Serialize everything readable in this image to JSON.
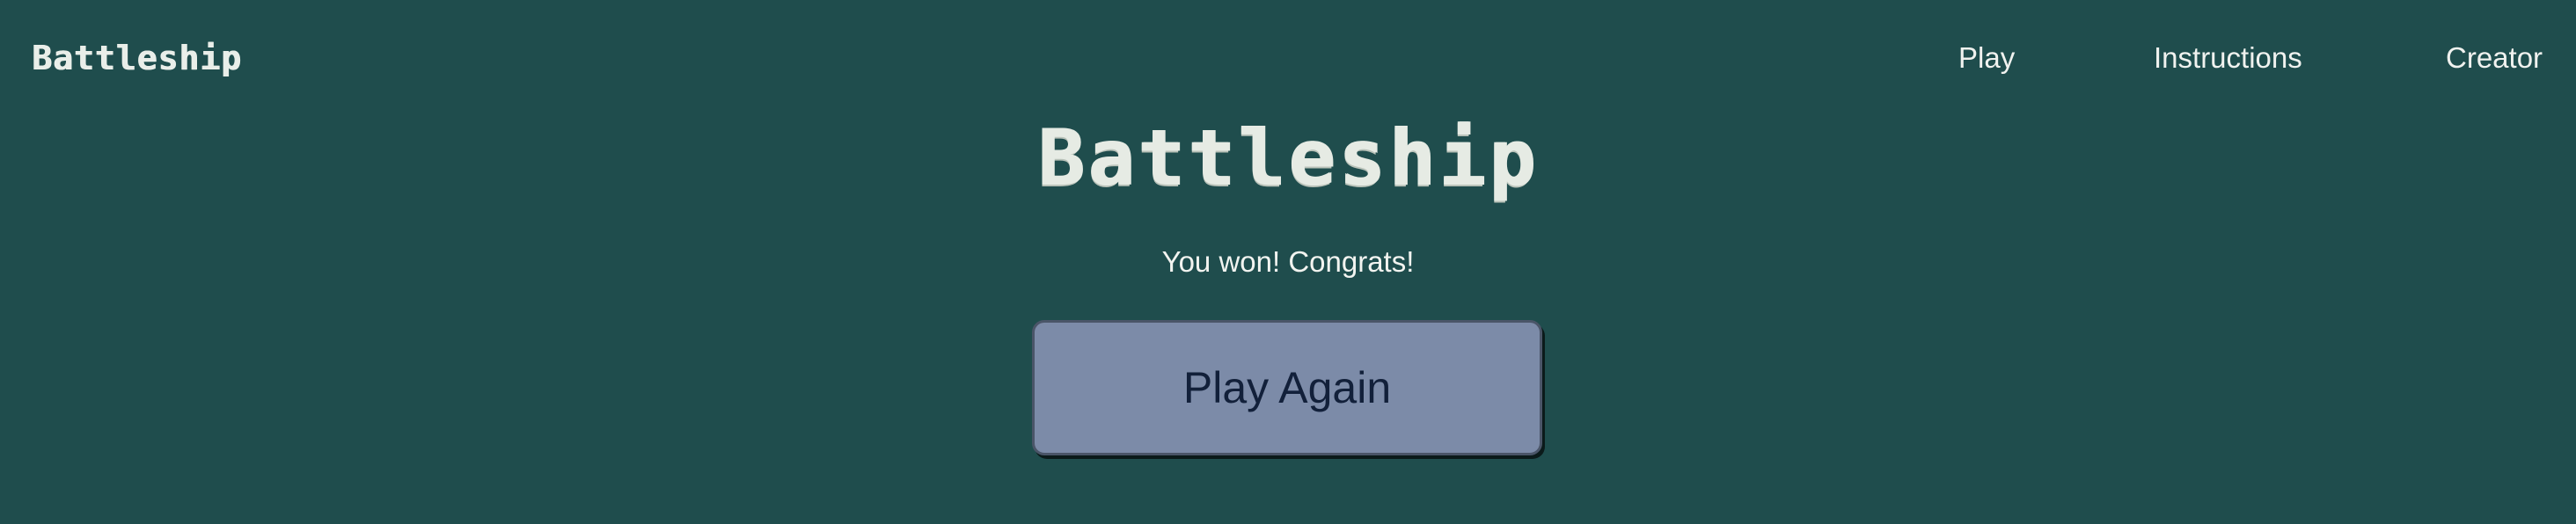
{
  "nav": {
    "brand": "Battleship",
    "links": [
      {
        "label": "Play"
      },
      {
        "label": "Instructions"
      },
      {
        "label": "Creator"
      }
    ]
  },
  "main": {
    "title": "Battleship",
    "status": "You won! Congrats!",
    "play_again_label": "Play Again"
  },
  "colors": {
    "background": "#1f4d4d",
    "text": "#e9eee9",
    "button_bg": "#7c8ba8",
    "button_text": "#12203a"
  }
}
